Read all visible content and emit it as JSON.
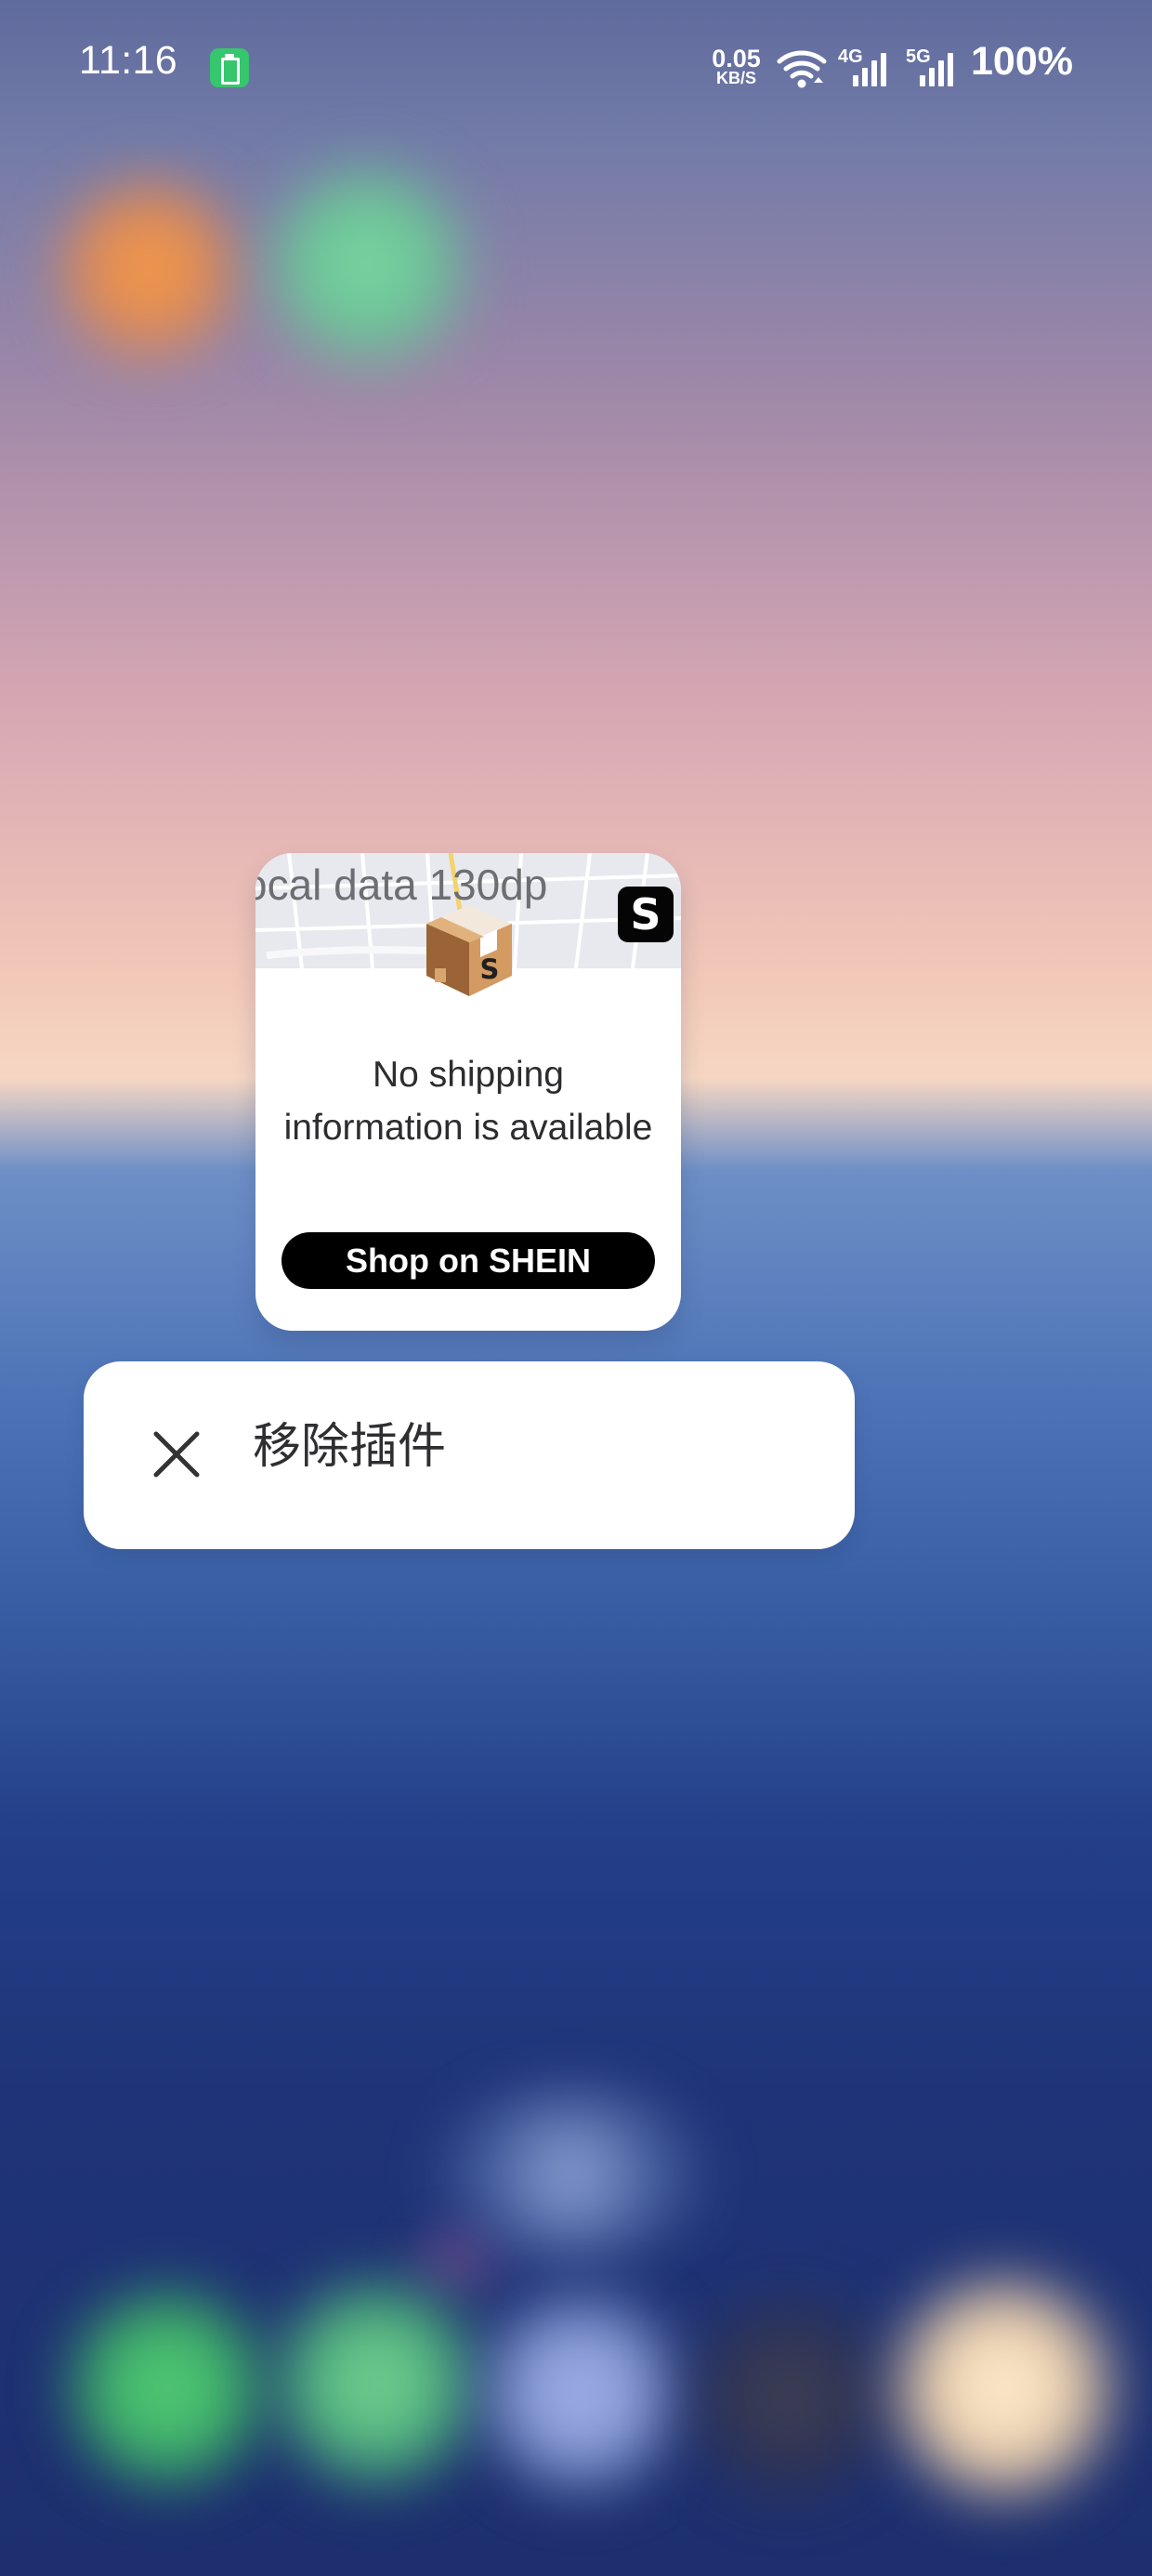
{
  "status_bar": {
    "time": "11:16",
    "network_speed": "0.05",
    "network_speed_unit": "KB/S",
    "network_4g": "4G",
    "network_5g": "5G",
    "battery_level": "100%",
    "icons": [
      "battery-saver-icon",
      "wifi-icon",
      "signal-4g-icon",
      "signal-5g-icon"
    ]
  },
  "widget": {
    "overlay_text": "ocal data 130dp",
    "brand_icon_text": "S",
    "parcel_label": "S",
    "message": {
      "line1": "No shipping",
      "line2": "information is available"
    },
    "button_label": "Shop on SHEIN",
    "colors": {
      "accent": "#000000",
      "card": "#ffffff"
    }
  },
  "menu": {
    "remove_label": "移除插件",
    "icon": "close-icon"
  }
}
